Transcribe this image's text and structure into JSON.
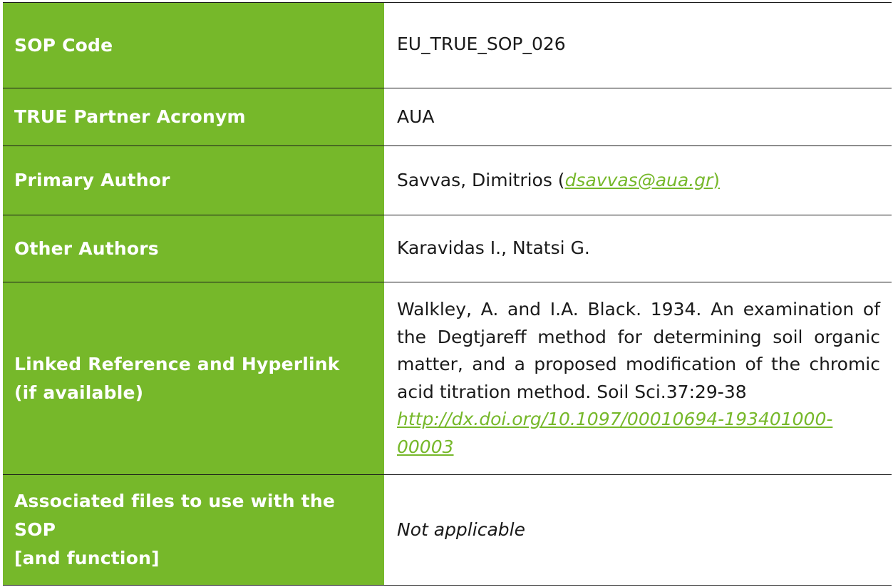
{
  "rows": [
    {
      "label": "SOP Code",
      "value": "EU_TRUE_SOP_026"
    },
    {
      "label": "TRUE Partner Acronym",
      "value": "AUA"
    },
    {
      "label": "Primary Author",
      "value_prefix": "Savvas, Dimitrios (",
      "email": "dsavvas@aua.gr",
      "value_suffix": ")"
    },
    {
      "label": "Other Authors",
      "value": "Karavidas I., Ntatsi G."
    },
    {
      "label_line1": "Linked Reference and Hyperlink",
      "label_line2": "(if available)",
      "reference_text": " Walkley, A. and I.A. Black. 1934. An examination of the Degtjareff method for determining soil organic matter, and a proposed modification of the chromic acid titration method. Soil Sci.37:29-38",
      "hyperlink": "http://dx.doi.org/10.1097/00010694-193401000-00003"
    },
    {
      "label_line1": "Associated files to use with the SOP",
      "label_line2": "[and function]",
      "value": "Not applicable"
    }
  ],
  "colors": {
    "label_bg": "#76b82a",
    "link": "#76b82a"
  }
}
